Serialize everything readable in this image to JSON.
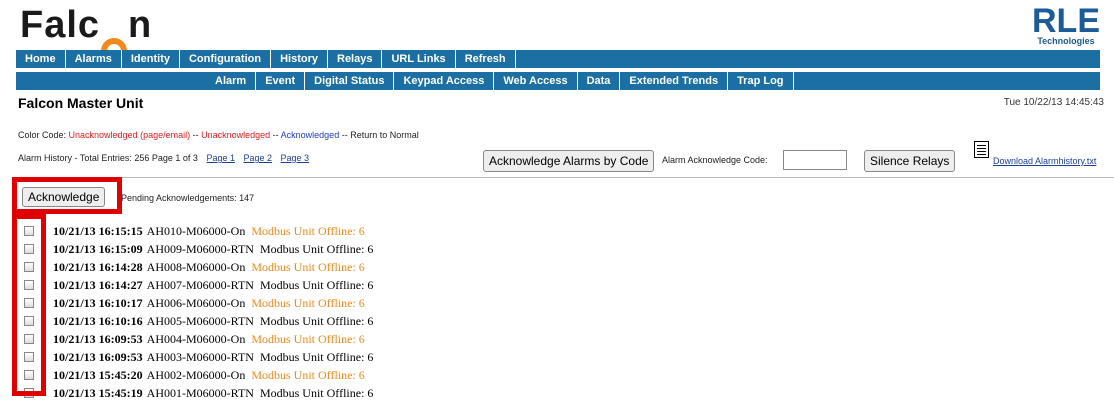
{
  "header": {
    "logo_text": "Falcon",
    "brand_main": "RLE",
    "brand_sub": "Technologies"
  },
  "nav_primary": [
    "Home",
    "Alarms",
    "Identity",
    "Configuration",
    "History",
    "Relays",
    "URL Links",
    "Refresh"
  ],
  "nav_secondary": [
    "Alarm",
    "Event",
    "Digital Status",
    "Keypad Access",
    "Web Access",
    "Data",
    "Extended Trends",
    "Trap Log"
  ],
  "page": {
    "title": "Falcon Master Unit",
    "datetime": "Tue 10/22/13 14:45:43"
  },
  "color_code": {
    "label": "Color Code: ",
    "red": "Unacknowledged (page/email)",
    "sep1": " -- ",
    "orange": "Unacknowledged",
    "sep2": " -- ",
    "blue": "Acknowledged",
    "rest": " -- Return to Normal"
  },
  "history": {
    "summary": "Alarm History - Total Entries: 256  Page 1 of 3",
    "pages": [
      "Page 1",
      "Page 2",
      "Page 3"
    ]
  },
  "actions": {
    "ack_by_code": "Acknowledge Alarms by Code",
    "ack_code_label": "Alarm Acknowledge Code:",
    "ack_code_value": "",
    "silence": "Silence Relays",
    "download": "Download Alarmhistory.txt",
    "acknowledge": "Acknowledge",
    "pending": "Pending Acknowledgements: 147"
  },
  "alarms": [
    {
      "ts": "10/21/13 16:15:15",
      "code": "AH010-M06000-On",
      "msg": "Modbus Unit Offline: 6",
      "color": "#f08a1c"
    },
    {
      "ts": "10/21/13 16:15:09",
      "code": "AH009-M06000-RTN",
      "msg": "Modbus Unit Offline: 6",
      "color": "#000000"
    },
    {
      "ts": "10/21/13 16:14:28",
      "code": "AH008-M06000-On",
      "msg": "Modbus Unit Offline: 6",
      "color": "#f08a1c"
    },
    {
      "ts": "10/21/13 16:14:27",
      "code": "AH007-M06000-RTN",
      "msg": "Modbus Unit Offline: 6",
      "color": "#000000"
    },
    {
      "ts": "10/21/13 16:10:17",
      "code": "AH006-M06000-On",
      "msg": "Modbus Unit Offline: 6",
      "color": "#f08a1c"
    },
    {
      "ts": "10/21/13 16:10:16",
      "code": "AH005-M06000-RTN",
      "msg": "Modbus Unit Offline: 6",
      "color": "#000000"
    },
    {
      "ts": "10/21/13 16:09:53",
      "code": "AH004-M06000-On",
      "msg": "Modbus Unit Offline: 6",
      "color": "#f08a1c"
    },
    {
      "ts": "10/21/13 16:09:53",
      "code": "AH003-M06000-RTN",
      "msg": "Modbus Unit Offline: 6",
      "color": "#000000"
    },
    {
      "ts": "10/21/13 15:45:20",
      "code": "AH002-M06000-On",
      "msg": "Modbus Unit Offline: 6",
      "color": "#f08a1c"
    },
    {
      "ts": "10/21/13 15:45:19",
      "code": "AH001-M06000-RTN",
      "msg": "Modbus Unit Offline: 6",
      "color": "#000000"
    }
  ],
  "colors": {
    "nav_bg": "#1b6fa3",
    "highlight_box": "#e00000",
    "brand_blue": "#1b5b98",
    "orange": "#f08a1c"
  }
}
